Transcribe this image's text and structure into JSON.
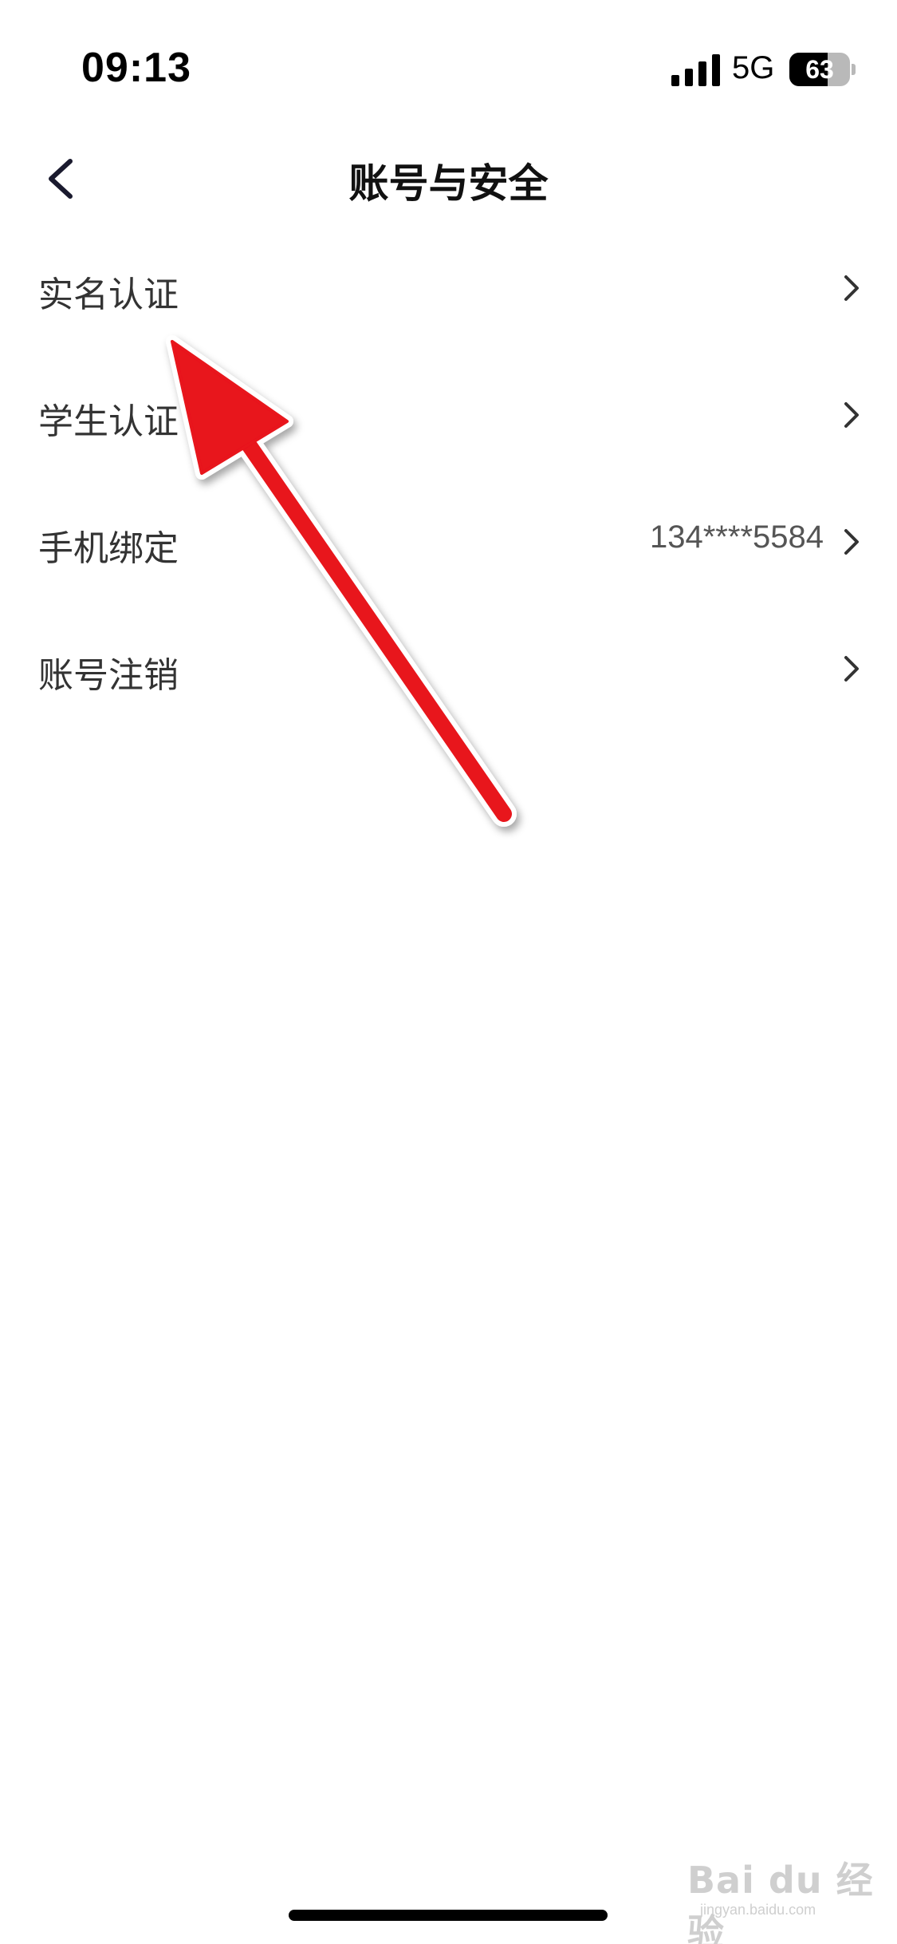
{
  "status_bar": {
    "time": "09:13",
    "network": "5G",
    "battery_level": "63",
    "battery_fraction": 0.63
  },
  "nav": {
    "title": "账号与安全",
    "back_icon": "chevron-left-icon"
  },
  "menu": {
    "items": [
      {
        "label": "实名认证",
        "value": "",
        "icon": "chevron-right-icon"
      },
      {
        "label": "学生认证",
        "value": "",
        "icon": "chevron-right-icon"
      },
      {
        "label": "手机绑定",
        "value": "134****5584",
        "icon": "chevron-right-icon"
      },
      {
        "label": "账号注销",
        "value": "",
        "icon": "chevron-right-icon"
      }
    ]
  },
  "annotation": {
    "arrow_color": "#e8121b",
    "arrow_outline": "#ffffff"
  },
  "watermark": {
    "text": "Bai du 经验",
    "sub": "jingyan.baidu.com"
  },
  "colors": {
    "background": "#ffffff",
    "text_primary": "#333333",
    "title": "#111111"
  }
}
